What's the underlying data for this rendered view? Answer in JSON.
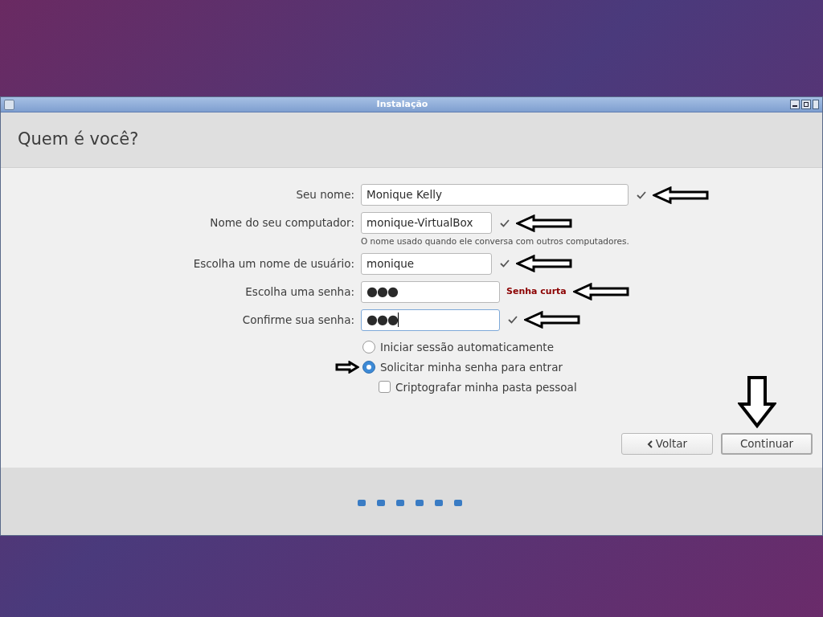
{
  "window": {
    "title": "Instalação"
  },
  "page_title": "Quem é você?",
  "fields": [
    {
      "label": "Seu nome:",
      "value": "Monique Kelly",
      "kind": "text",
      "valid": true,
      "focused": false,
      "annotated": true
    },
    {
      "label": "Nome do seu computador:",
      "value": "monique-VirtualBox",
      "kind": "text",
      "valid": true,
      "focused": false,
      "annotated": true,
      "hint": "O nome usado quando ele conversa com outros computadores."
    },
    {
      "label": "Escolha um nome de usuário:",
      "value": "monique",
      "kind": "text",
      "valid": true,
      "focused": false,
      "annotated": true
    },
    {
      "label": "Escolha uma senha:",
      "value": "●●●",
      "kind": "password",
      "valid": false,
      "error": "Senha curta",
      "focused": false,
      "annotated": true
    },
    {
      "label": "Confirme sua senha:",
      "value": "●●●",
      "kind": "password",
      "valid": true,
      "focused": true,
      "annotated": true
    }
  ],
  "login_options": [
    {
      "label": "Iniciar sessão automaticamente",
      "kind": "radio",
      "selected": false,
      "annotated": false
    },
    {
      "label": "Solicitar minha senha para entrar",
      "kind": "radio",
      "selected": true,
      "annotated": true
    },
    {
      "label": "Criptografar minha pasta pessoal",
      "kind": "checkbox",
      "checked": false,
      "annotated": false
    }
  ],
  "buttons": [
    {
      "label": "Voltar",
      "kind": "back",
      "default": false,
      "annotated": false
    },
    {
      "label": "Continuar",
      "kind": "next",
      "default": true,
      "annotated": true
    }
  ],
  "progress": [
    {
      "current": false
    },
    {
      "current": false
    },
    {
      "current": false
    },
    {
      "current": false
    },
    {
      "current": false
    },
    {
      "current": false
    }
  ]
}
